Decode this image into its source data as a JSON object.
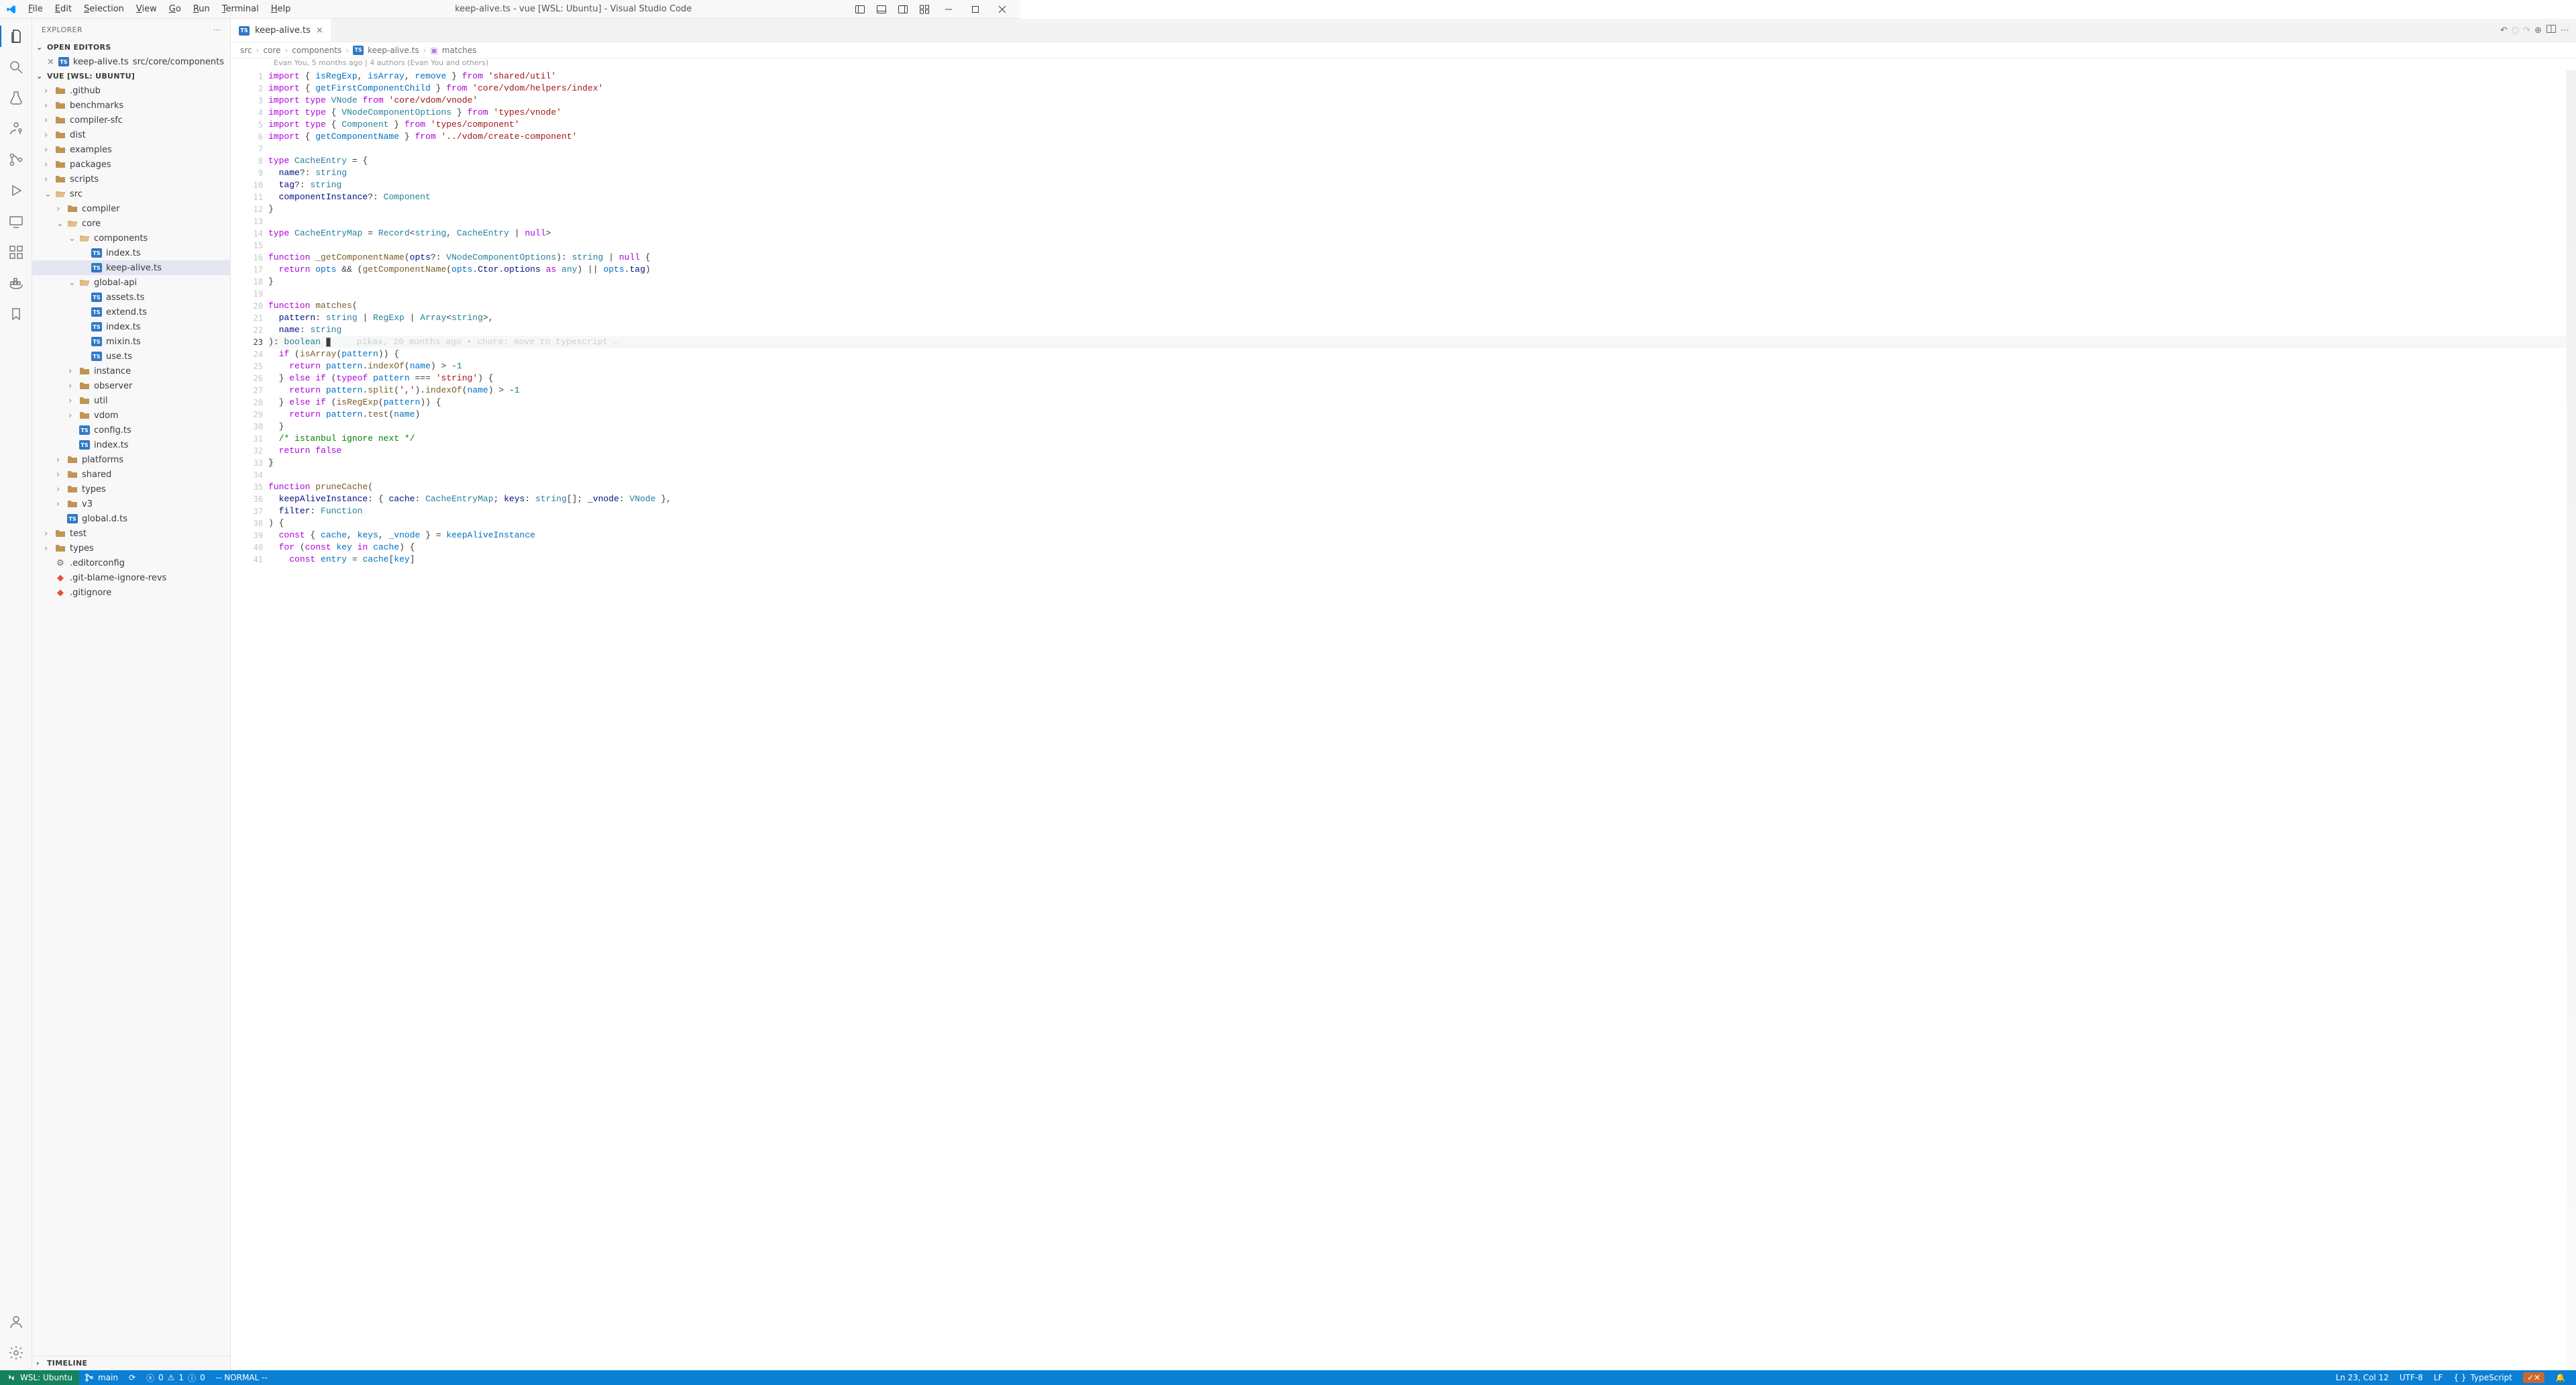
{
  "window": {
    "title": "keep-alive.ts - vue [WSL: Ubuntu] - Visual Studio Code"
  },
  "menu": [
    "File",
    "Edit",
    "Selection",
    "View",
    "Go",
    "Run",
    "Terminal",
    "Help"
  ],
  "explorer": {
    "title": "EXPLORER",
    "open_editors_label": "OPEN EDITORS",
    "open_editors": [
      {
        "name": "keep-alive.ts",
        "hint": "src/core/components"
      }
    ],
    "workspace_label": "VUE [WSL: UBUNTU]",
    "timeline_label": "TIMELINE",
    "tree": [
      {
        "d": 1,
        "t": "folder",
        "name": ".github"
      },
      {
        "d": 1,
        "t": "folder",
        "name": "benchmarks"
      },
      {
        "d": 1,
        "t": "folder",
        "name": "compiler-sfc"
      },
      {
        "d": 1,
        "t": "folder",
        "name": "dist"
      },
      {
        "d": 1,
        "t": "folder",
        "name": "examples"
      },
      {
        "d": 1,
        "t": "folder",
        "name": "packages"
      },
      {
        "d": 1,
        "t": "folder",
        "name": "scripts"
      },
      {
        "d": 1,
        "t": "folder-open",
        "name": "src"
      },
      {
        "d": 2,
        "t": "folder",
        "name": "compiler"
      },
      {
        "d": 2,
        "t": "folder-open",
        "name": "core"
      },
      {
        "d": 3,
        "t": "folder-open",
        "name": "components"
      },
      {
        "d": 4,
        "t": "ts",
        "name": "index.ts"
      },
      {
        "d": 4,
        "t": "ts",
        "name": "keep-alive.ts",
        "sel": true
      },
      {
        "d": 3,
        "t": "folder-open",
        "name": "global-api"
      },
      {
        "d": 4,
        "t": "ts",
        "name": "assets.ts"
      },
      {
        "d": 4,
        "t": "ts",
        "name": "extend.ts"
      },
      {
        "d": 4,
        "t": "ts",
        "name": "index.ts"
      },
      {
        "d": 4,
        "t": "ts",
        "name": "mixin.ts"
      },
      {
        "d": 4,
        "t": "ts",
        "name": "use.ts"
      },
      {
        "d": 3,
        "t": "folder",
        "name": "instance"
      },
      {
        "d": 3,
        "t": "folder",
        "name": "observer"
      },
      {
        "d": 3,
        "t": "folder",
        "name": "util"
      },
      {
        "d": 3,
        "t": "folder",
        "name": "vdom"
      },
      {
        "d": 3,
        "t": "ts",
        "name": "config.ts"
      },
      {
        "d": 3,
        "t": "ts",
        "name": "index.ts"
      },
      {
        "d": 2,
        "t": "folder",
        "name": "platforms"
      },
      {
        "d": 2,
        "t": "folder",
        "name": "shared"
      },
      {
        "d": 2,
        "t": "folder",
        "name": "types"
      },
      {
        "d": 2,
        "t": "folder",
        "name": "v3"
      },
      {
        "d": 2,
        "t": "ts",
        "name": "global.d.ts"
      },
      {
        "d": 1,
        "t": "folder",
        "name": "test"
      },
      {
        "d": 1,
        "t": "folder",
        "name": "types"
      },
      {
        "d": 1,
        "t": "cfg",
        "name": ".editorconfig"
      },
      {
        "d": 1,
        "t": "git",
        "name": ".git-blame-ignore-revs"
      },
      {
        "d": 1,
        "t": "git",
        "name": ".gitignore"
      }
    ]
  },
  "tab": {
    "name": "keep-alive.ts"
  },
  "breadcrumbs": [
    "src",
    "core",
    "components",
    "keep-alive.ts",
    "matches"
  ],
  "blame_header": "Evan You, 5 months ago | 4 authors (Evan You and others)",
  "current_line_blame": "     pikax, 20 months ago • chore: move to typescript …",
  "status": {
    "remote": "WSL: Ubuntu",
    "branch": "main",
    "sync": "⟳",
    "errors": "0",
    "warnings": "1",
    "info": "0",
    "mode": "-- NORMAL --",
    "cursor": "Ln 23, Col 12",
    "encoding": "UTF-8",
    "eol": "LF",
    "lang": "TypeScript"
  },
  "code": [
    {
      "n": 1,
      "h": "<span class='kw'>import</span> { <span class='id'>isRegExp</span>, <span class='id'>isArray</span>, <span class='id'>remove</span> } <span class='kw'>from</span> <span class='str'>'shared/util'</span>"
    },
    {
      "n": 2,
      "h": "<span class='kw'>import</span> { <span class='id'>getFirstComponentChild</span> } <span class='kw'>from</span> <span class='str'>'core/vdom/helpers/index'</span>"
    },
    {
      "n": 3,
      "h": "<span class='kw'>import</span> <span class='kw'>type</span> <span class='type'>VNode</span> <span class='kw'>from</span> <span class='str'>'core/vdom/vnode'</span>"
    },
    {
      "n": 4,
      "h": "<span class='kw'>import</span> <span class='kw'>type</span> { <span class='type'>VNodeComponentOptions</span> } <span class='kw'>from</span> <span class='str'>'types/vnode'</span>"
    },
    {
      "n": 5,
      "h": "<span class='kw'>import</span> <span class='kw'>type</span> { <span class='type'>Component</span> } <span class='kw'>from</span> <span class='str'>'types/component'</span>"
    },
    {
      "n": 6,
      "h": "<span class='kw'>import</span> { <span class='id'>getComponentName</span> } <span class='kw'>from</span> <span class='str'>'../vdom/create-component'</span>"
    },
    {
      "n": 7,
      "h": ""
    },
    {
      "n": 8,
      "h": "<span class='kw'>type</span> <span class='type'>CacheEntry</span> = {"
    },
    {
      "n": 9,
      "h": "  <span class='prop'>name</span>?: <span class='type'>string</span>"
    },
    {
      "n": 10,
      "h": "  <span class='prop'>tag</span>?: <span class='type'>string</span>"
    },
    {
      "n": 11,
      "h": "  <span class='prop'>componentInstance</span>?: <span class='type'>Component</span>"
    },
    {
      "n": 12,
      "h": "}"
    },
    {
      "n": 13,
      "h": ""
    },
    {
      "n": 14,
      "h": "<span class='kw'>type</span> <span class='type'>CacheEntryMap</span> = <span class='type'>Record</span>&lt;<span class='type'>string</span>, <span class='type'>CacheEntry</span> | <span class='kw'>null</span>&gt;"
    },
    {
      "n": 15,
      "h": ""
    },
    {
      "n": 16,
      "h": "<span class='kw'>function</span> <span class='fn'>_getComponentName</span>(<span class='prop'>opts</span>?: <span class='type'>VNodeComponentOptions</span>): <span class='type'>string</span> | <span class='kw'>null</span> {"
    },
    {
      "n": 17,
      "h": "  <span class='kw'>return</span> <span class='id'>opts</span> &amp;&amp; (<span class='fn'>getComponentName</span>(<span class='id'>opts</span>.<span class='prop'>Ctor</span>.<span class='prop'>options</span> <span class='kw'>as</span> <span class='type'>any</span>) || <span class='id'>opts</span>.<span class='prop'>tag</span>)"
    },
    {
      "n": 18,
      "h": "}"
    },
    {
      "n": 19,
      "h": ""
    },
    {
      "n": 20,
      "h": "<span class='kw'>function</span> <span class='fn'>matches</span>("
    },
    {
      "n": 21,
      "h": "  <span class='prop'>pattern</span>: <span class='type'>string</span> | <span class='type'>RegExp</span> | <span class='type'>Array</span>&lt;<span class='type'>string</span>&gt;,"
    },
    {
      "n": 22,
      "h": "  <span class='prop'>name</span>: <span class='type'>string</span>"
    },
    {
      "n": 23,
      "h": "): <span class='type'>boolean</span> <span class='cursor-blk'></span><span class='blame-inline' data-bind='current_line_blame'></span>",
      "cur": true
    },
    {
      "n": 24,
      "h": "  <span class='kw'>if</span> (<span class='fn'>isArray</span>(<span class='id'>pattern</span>)) {"
    },
    {
      "n": 25,
      "h": "    <span class='kw'>return</span> <span class='id'>pattern</span>.<span class='fn'>indexOf</span>(<span class='id'>name</span>) &gt; -<span class='num'>1</span>"
    },
    {
      "n": 26,
      "h": "  } <span class='kw'>else</span> <span class='kw'>if</span> (<span class='kw'>typeof</span> <span class='id'>pattern</span> === <span class='str'>'string'</span>) {"
    },
    {
      "n": 27,
      "h": "    <span class='kw'>return</span> <span class='id'>pattern</span>.<span class='fn'>split</span>(<span class='str'>','</span>).<span class='fn'>indexOf</span>(<span class='id'>name</span>) &gt; -<span class='num'>1</span>"
    },
    {
      "n": 28,
      "h": "  } <span class='kw'>else</span> <span class='kw'>if</span> (<span class='fn'>isRegExp</span>(<span class='id'>pattern</span>)) {"
    },
    {
      "n": 29,
      "h": "    <span class='kw'>return</span> <span class='id'>pattern</span>.<span class='fn'>test</span>(<span class='id'>name</span>)"
    },
    {
      "n": 30,
      "h": "  }"
    },
    {
      "n": 31,
      "h": "  <span class='cmt'>/* istanbul ignore next */</span>"
    },
    {
      "n": 32,
      "h": "  <span class='kw'>return</span> <span class='kw'>false</span>"
    },
    {
      "n": 33,
      "h": "<span style='background:#e8ffe0;'>}</span>"
    },
    {
      "n": 34,
      "h": ""
    },
    {
      "n": 35,
      "h": "<span class='kw'>function</span> <span class='fn'>pruneCache</span>("
    },
    {
      "n": 36,
      "h": "  <span class='prop'>keepAliveInstance</span>: { <span class='prop'>cache</span>: <span class='type'>CacheEntryMap</span>; <span class='prop'>keys</span>: <span class='type'>string</span>[]; <span class='prop'>_vnode</span>: <span class='type'>VNode</span> },"
    },
    {
      "n": 37,
      "h": "  <span class='prop'>filter</span>: <span class='type'>Function</span>"
    },
    {
      "n": 38,
      "h": ") {"
    },
    {
      "n": 39,
      "h": "  <span class='kw'>const</span> { <span class='id'>cache</span>, <span class='id'>keys</span>, <span class='id'>_vnode</span> } = <span class='id'>keepAliveInstance</span>"
    },
    {
      "n": 40,
      "h": "  <span class='kw'>for</span> (<span class='kw'>const</span> <span class='id'>key</span> <span class='kw'>in</span> <span class='id'>cache</span>) {"
    },
    {
      "n": 41,
      "h": "    <span class='kw'>const</span> <span class='id'>entry</span> = <span class='id'>cache</span>[<span class='id'>key</span>]"
    }
  ]
}
